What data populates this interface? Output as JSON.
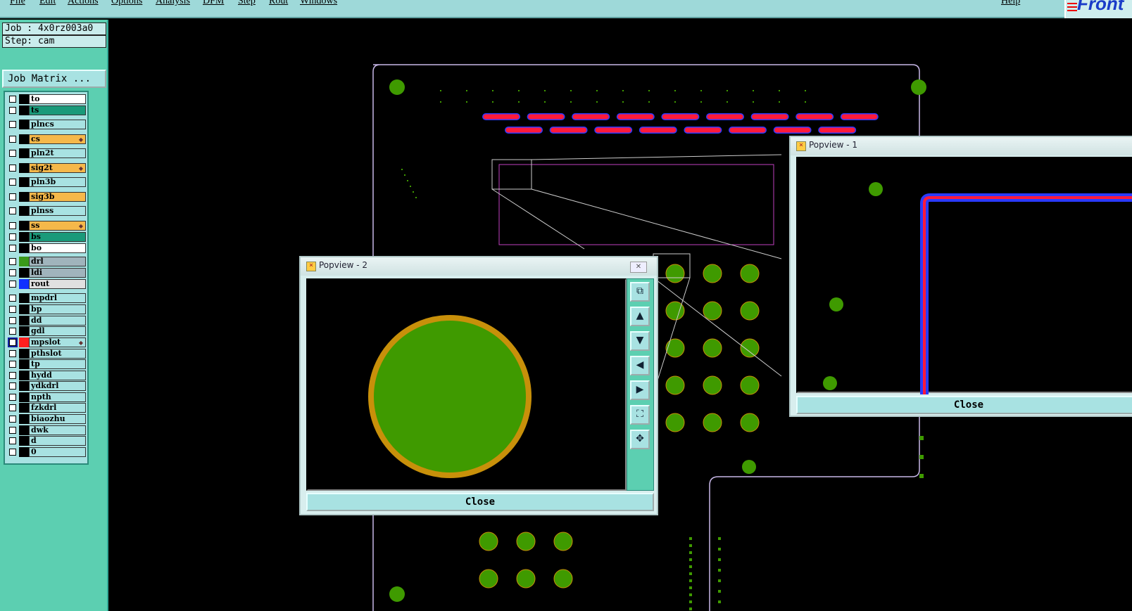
{
  "menu": {
    "items": [
      "File",
      "Edit",
      "Actions",
      "Options",
      "Analysis",
      "DFM",
      "Step",
      "Rout",
      "Windows"
    ],
    "help": "Help"
  },
  "logo": {
    "text": "Front"
  },
  "job": {
    "job_label": "Job : 4x0rz003a0",
    "step_label": "Step: cam",
    "matrix_button": "Job Matrix ..."
  },
  "layers": [
    {
      "name": "to",
      "bg": "#ffffff",
      "sw": "#000000"
    },
    {
      "name": "ts",
      "bg": "#1a9a7a",
      "sw": "#000000"
    },
    {
      "name": "plncs",
      "bg": "#a8e2e2",
      "sw": "#000000"
    },
    {
      "name": "cs",
      "bg": "#f5b84a",
      "sw": "#000000",
      "mark": true
    },
    {
      "name": "pln2t",
      "bg": "#a8e2e2",
      "sw": "#000000"
    },
    {
      "name": "sig2t",
      "bg": "#f5b84a",
      "sw": "#000000",
      "mark": true
    },
    {
      "name": "pln3b",
      "bg": "#a8e2e2",
      "sw": "#000000"
    },
    {
      "name": "sig3b",
      "bg": "#f5b84a",
      "sw": "#000000"
    },
    {
      "name": "plnss",
      "bg": "#a8e2e2",
      "sw": "#000000"
    },
    {
      "name": "ss",
      "bg": "#f5b84a",
      "sw": "#000000",
      "mark": true
    },
    {
      "name": "bs",
      "bg": "#1a9a7a",
      "sw": "#000000"
    },
    {
      "name": "bo",
      "bg": "#ffffff",
      "sw": "#000000"
    },
    {
      "name": "drl",
      "bg": "#a0b4bc",
      "sw": "#3a9a1a"
    },
    {
      "name": "ldi",
      "bg": "#a0b4bc",
      "sw": "#000000"
    },
    {
      "name": "rout",
      "bg": "#e0e0e0",
      "sw": "#1030ff"
    },
    {
      "name": "mpdrl",
      "bg": "#a8e2e2",
      "sw": "#000000"
    },
    {
      "name": "bp",
      "bg": "#a8e2e2",
      "sw": "#000000"
    },
    {
      "name": "dd",
      "bg": "#a8e2e2",
      "sw": "#000000"
    },
    {
      "name": "gdl",
      "bg": "#a8e2e2",
      "sw": "#000000"
    },
    {
      "name": "mpslot",
      "bg": "#a8e2e2",
      "sw": "#ff2020",
      "mark": true,
      "active": true
    },
    {
      "name": "pthslot",
      "bg": "#a8e2e2",
      "sw": "#000000"
    },
    {
      "name": "tp",
      "bg": "#a8e2e2",
      "sw": "#000000"
    },
    {
      "name": "hydd",
      "bg": "#a8e2e2",
      "sw": "#000000"
    },
    {
      "name": "ydkdrl",
      "bg": "#a8e2e2",
      "sw": "#000000"
    },
    {
      "name": "npth",
      "bg": "#a8e2e2",
      "sw": "#000000"
    },
    {
      "name": "fzkdrl",
      "bg": "#a8e2e2",
      "sw": "#000000"
    },
    {
      "name": "biaozhu",
      "bg": "#a8e2e2",
      "sw": "#000000"
    },
    {
      "name": "dwk",
      "bg": "#a8e2e2",
      "sw": "#000000"
    },
    {
      "name": "d",
      "bg": "#a8e2e2",
      "sw": "#000000"
    },
    {
      "name": "0",
      "bg": "#a8e2e2",
      "sw": "#000000"
    }
  ],
  "popview1": {
    "title": "Popview - 1",
    "close": "Close"
  },
  "popview2": {
    "title": "Popview - 2",
    "close": "Close"
  },
  "colors": {
    "pad": "#3f9a00",
    "pad_ring": "#c8900a",
    "outline": "#c8b8e8",
    "trace_red": "#ff1a3a",
    "trace_blue": "#2a3aff",
    "panel": "#5ccfb1"
  },
  "icons": [
    "zoom-home-icon",
    "pan-up-icon",
    "pan-down-icon",
    "pan-left-icon",
    "pan-right-icon",
    "zoom-fit-icon",
    "zoom-center-icon"
  ]
}
